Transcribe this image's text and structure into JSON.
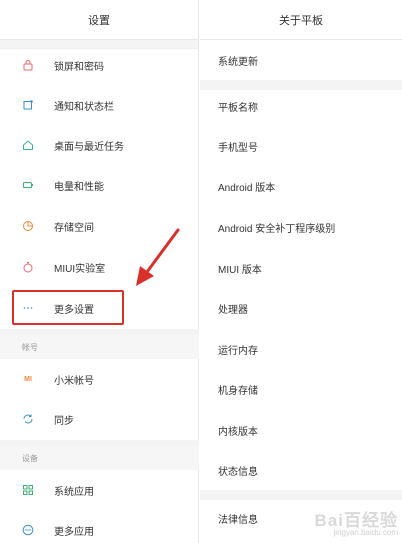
{
  "left_panel": {
    "title": "设置",
    "items_top": [
      {
        "label": "锁屏和密码",
        "icon": "lock-icon",
        "color": "#e56a6a"
      },
      {
        "label": "通知和状态栏",
        "icon": "notification-icon",
        "color": "#3a8fd6"
      },
      {
        "label": "桌面与最近任务",
        "icon": "home-icon",
        "color": "#3cb39a"
      },
      {
        "label": "电量和性能",
        "icon": "battery-icon",
        "color": "#3cb371"
      },
      {
        "label": "存储空间",
        "icon": "storage-icon",
        "color": "#f08a3c"
      },
      {
        "label": "MIUI实验室",
        "icon": "lab-icon",
        "color": "#e56a6a"
      },
      {
        "label": "更多设置",
        "icon": "more-icon",
        "color": "#3a8fd6"
      }
    ],
    "section_account": "帐号",
    "items_account": [
      {
        "label": "小米帐号",
        "icon": "mi-icon",
        "mark": "MI",
        "color": "#f08a3c"
      },
      {
        "label": "同步",
        "icon": "sync-icon",
        "color": "#3a8fd6"
      }
    ],
    "section_device": "设备",
    "items_device": [
      {
        "label": "系统应用",
        "icon": "apps-grid-icon",
        "color": "#3cb371"
      },
      {
        "label": "更多应用",
        "icon": "more-apps-icon",
        "color": "#3a8fd6"
      }
    ]
  },
  "right_panel": {
    "title": "关于平板",
    "items_top": [
      "系统更新"
    ],
    "items_main": [
      "平板名称",
      "手机型号",
      "Android 版本",
      "Android 安全补丁程序级别",
      "MIUI 版本",
      "处理器",
      "运行内存",
      "机身存储",
      "内核版本",
      "状态信息"
    ],
    "items_bottom": [
      "法律信息"
    ]
  },
  "annotation": {
    "highlight_color": "#d9302c",
    "arrow_color": "#d9302c"
  },
  "watermark": {
    "text": "Bai百经验",
    "url": "jingyan.baidu.com"
  }
}
